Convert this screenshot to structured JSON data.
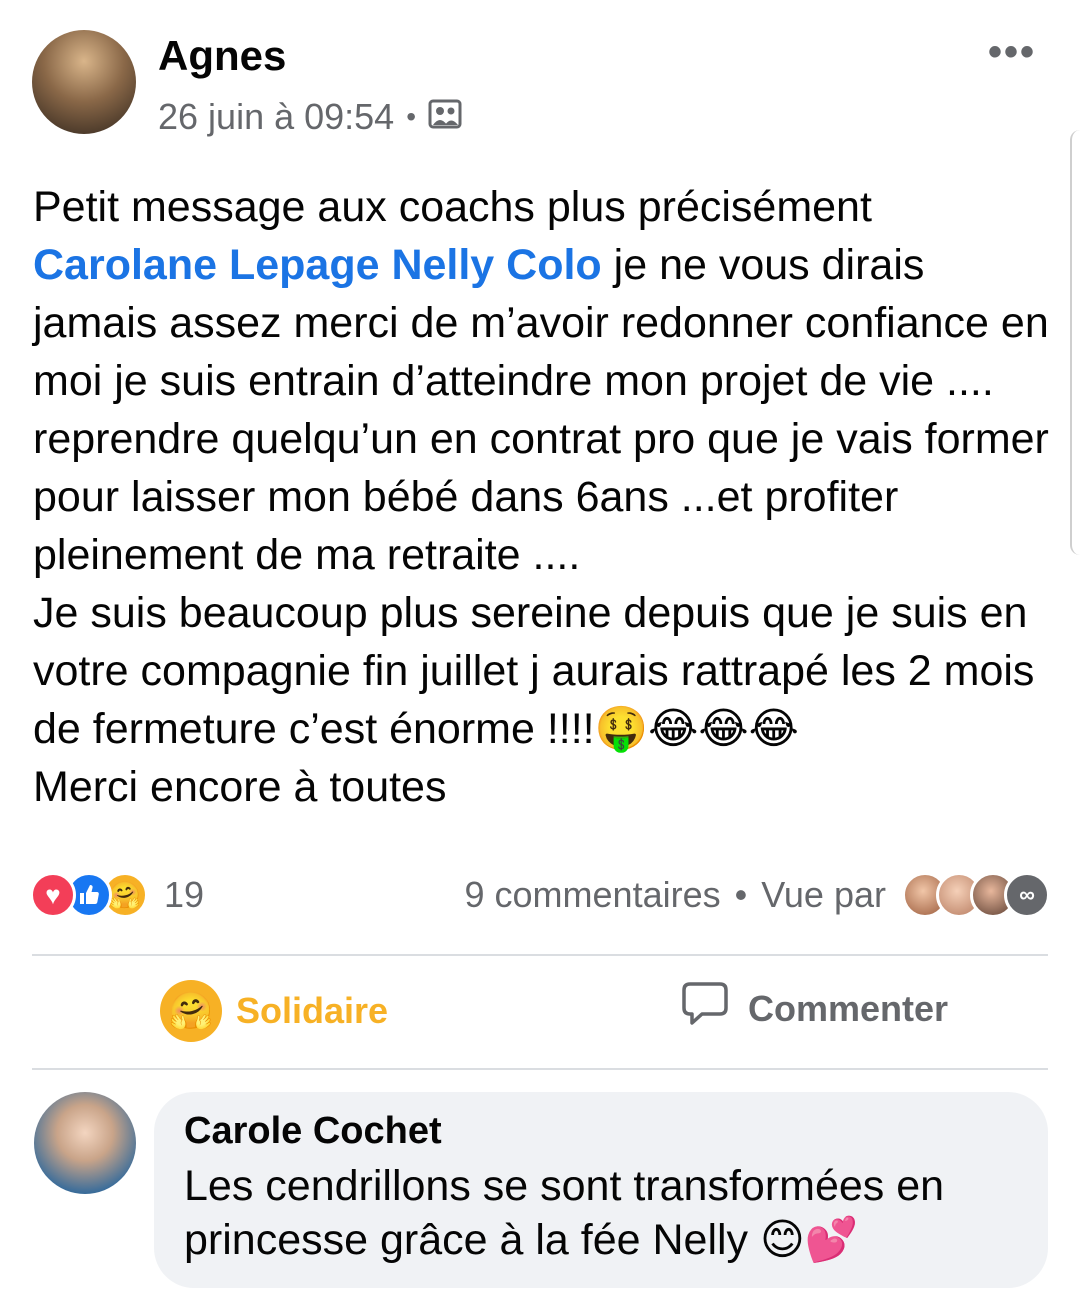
{
  "post": {
    "author": "Agnes",
    "timestamp": "26 juin à 09:54",
    "visibility_icon": "group-icon",
    "more_icon": "more-horizontal-icon",
    "more_label": "•••",
    "text_intro": "Petit message aux coachs plus précisément ",
    "mention": "Carolane Lepage Nelly Colo",
    "text_after_mention": " je ne vous dirais jamais assez merci de m’avoir redonner confiance en moi je suis entrain d’atteindre mon projet de vie .... reprendre quelqu’un en contrat pro que je vais former pour laisser mon bébé dans 6ans ...et profiter pleinement de ma retraite ....",
    "text_paragraph2": "Je suis beaucoup plus sereine depuis que je suis en votre compagnie fin juillet j aurais rattrapé les 2 mois de fermeture c’est énorme !!!!🤑😂😂😂",
    "text_paragraph3": "Merci encore à toutes"
  },
  "stats": {
    "reactions": [
      "love-reaction-icon",
      "like-reaction-icon",
      "care-reaction-icon"
    ],
    "reaction_count": "19",
    "comments": "9 commentaires",
    "seen_by": "Vue par",
    "viewers_more": "∞"
  },
  "actions": {
    "solidaire": "Solidaire",
    "comment": "Commenter"
  },
  "comment": {
    "author": "Carole Cochet",
    "text": "Les cendrillons se sont transformées en princesse grâce à la fée Nelly 😊💕"
  },
  "colors": {
    "mention": "#1b74e4",
    "secondary_text": "#65676b",
    "care_yellow": "#f7b125",
    "bubble_bg": "#f0f2f5",
    "divider": "#dadde1"
  }
}
